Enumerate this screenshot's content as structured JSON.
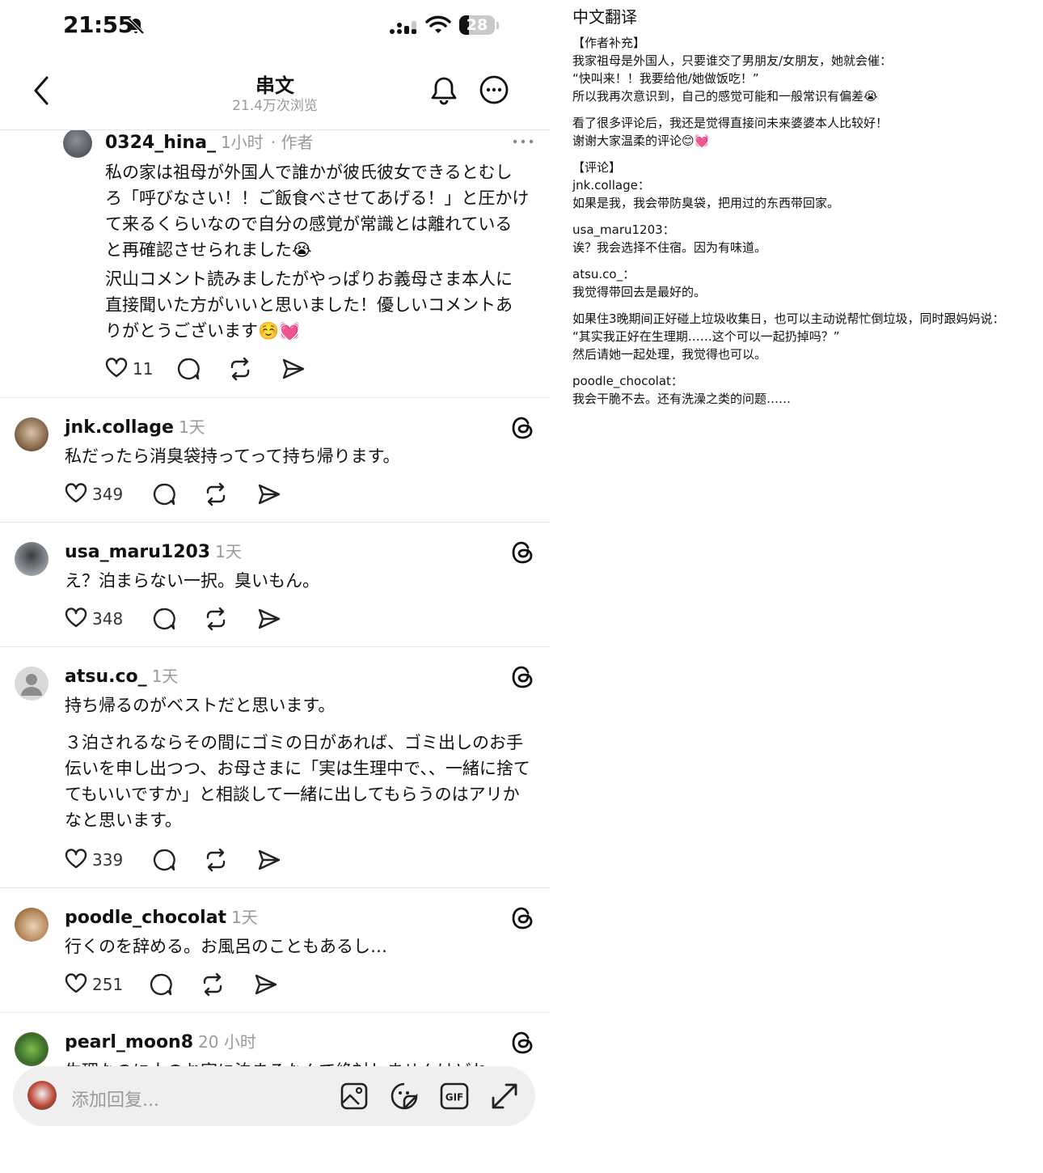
{
  "status_bar": {
    "time": "21:55",
    "battery": "28",
    "battery_level": 0.28
  },
  "header": {
    "title": "串文",
    "views": "21.4万次浏览"
  },
  "author_post": {
    "username": "0324_hina_",
    "time": "1小时",
    "tag": "· 作者",
    "text_lines": [
      "私の家は祖母が外国人で誰かが彼氏彼女できるとむし",
      "ろ「呼びなさい！！ご飯食べさせてあげる！」と圧かけ",
      "て来るくらいなので自分の感覚が常識とは離れている",
      "と再確認させられました😭",
      "沢山コメント読みましたがやっぱりお義母さま本人に",
      "直接聞いた方がいいと思いました！優しいコメントあ",
      "りがとうございます☺️💓"
    ],
    "likes": "11"
  },
  "replies": [
    {
      "username": "jnk.collage",
      "time": "1天",
      "paragraphs": [
        "私だったら消臭袋持ってって持ち帰ります。"
      ],
      "likes": "349"
    },
    {
      "username": "usa_maru1203",
      "time": "1天",
      "paragraphs": [
        "え？泊まらない一択。臭いもん。"
      ],
      "likes": "348"
    },
    {
      "username": "atsu.co_",
      "time": "1天",
      "paragraphs": [
        "持ち帰るのがベストだと思います。",
        "３泊されるならその間にゴミの日があれば、ゴミ出しのお手伝いを申し出つつ、お母さまに「実は生理中で、、一緒に捨ててもいいですか」と相談して一緒に出してもらうのはアリかなと思います。"
      ],
      "likes": "339"
    },
    {
      "username": "poodle_chocolat",
      "time": "1天",
      "paragraphs": [
        "行くのを辞める。お風呂のこともあるし…"
      ],
      "likes": "251"
    },
    {
      "username": "pearl_moon8",
      "time": "20 小时",
      "paragraphs": [
        "生理なのに人のお家に泊まるなんて絶対しませんけどね"
      ],
      "likes": ""
    }
  ],
  "composer": {
    "placeholder": "添加回复..."
  },
  "translation": {
    "title": "中文翻译",
    "blocks": [
      [
        "【作者补充】",
        "我家祖母是外国人，只要谁交了男朋友/女朋友，她就会催：",
        "“快叫来！！我要给他/她做饭吃！”",
        "所以我再次意识到，自己的感觉可能和一般常识有偏差😭"
      ],
      [
        "看了很多评论后，我还是觉得直接问未来婆婆本人比较好！",
        "谢谢大家温柔的评论😊💓"
      ],
      [
        "【评论】",
        "jnk.collage：",
        "如果是我，我会带防臭袋，把用过的东西带回家。"
      ],
      [
        "usa_maru1203：",
        "诶？我会选择不住宿。因为有味道。"
      ],
      [
        "atsu.co_：",
        "我觉得带回去是最好的。"
      ],
      [
        "如果住3晚期间正好碰上垃圾收集日，也可以主动说帮忙倒垃圾，同时跟妈妈说：",
        "“其实我正好在生理期……这个可以一起扔掉吗？”",
        "然后请她一起处理，我觉得也可以。"
      ],
      [
        "poodle_chocolat：",
        "我会干脆不去。还有洗澡之类的问题……"
      ]
    ]
  },
  "colors": {
    "text": "#111111",
    "muted": "#9a9a9a",
    "divider": "#e5e5e5",
    "composer_bg": "#efefef"
  },
  "icons": [
    "back-icon",
    "bell-icon",
    "more-icon",
    "heart-icon",
    "comment-icon",
    "repost-icon",
    "share-icon",
    "threads-icon",
    "image-icon",
    "sticker-icon",
    "gif-icon",
    "expand-icon"
  ]
}
